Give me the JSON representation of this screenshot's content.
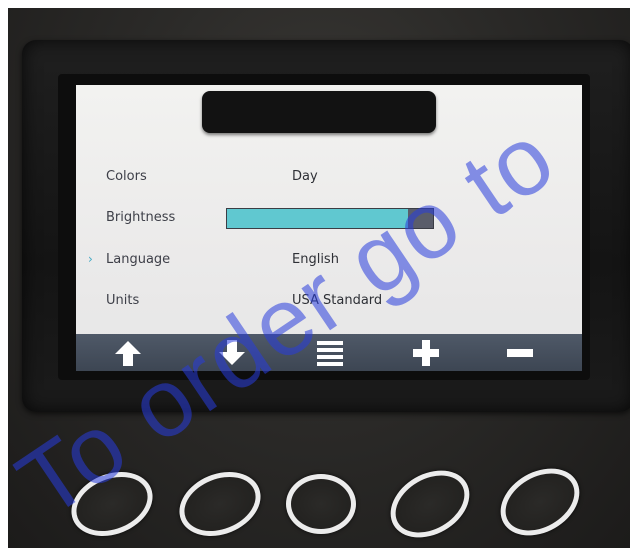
{
  "settings": {
    "rows": [
      {
        "label": "Colors",
        "value": "Day",
        "selected": false
      },
      {
        "label": "Brightness",
        "value": "",
        "selected": false
      },
      {
        "label": "Language",
        "value": "English",
        "selected": true
      },
      {
        "label": "Units",
        "value": "USA Standard",
        "selected": false
      }
    ],
    "selected_marker": "›",
    "brightness_level": 0.88
  },
  "toolbar": {
    "buttons": [
      "arrow-up-icon",
      "arrow-down-icon",
      "menu-icon",
      "plus-icon",
      "minus-icon"
    ]
  },
  "watermark": {
    "text": "To order go to"
  },
  "colors": {
    "screen_bg": "#ebeaea",
    "brightness_fill": "#60c8d0",
    "toolbar_bg": "#46505e",
    "accent": "#44a9c4"
  }
}
